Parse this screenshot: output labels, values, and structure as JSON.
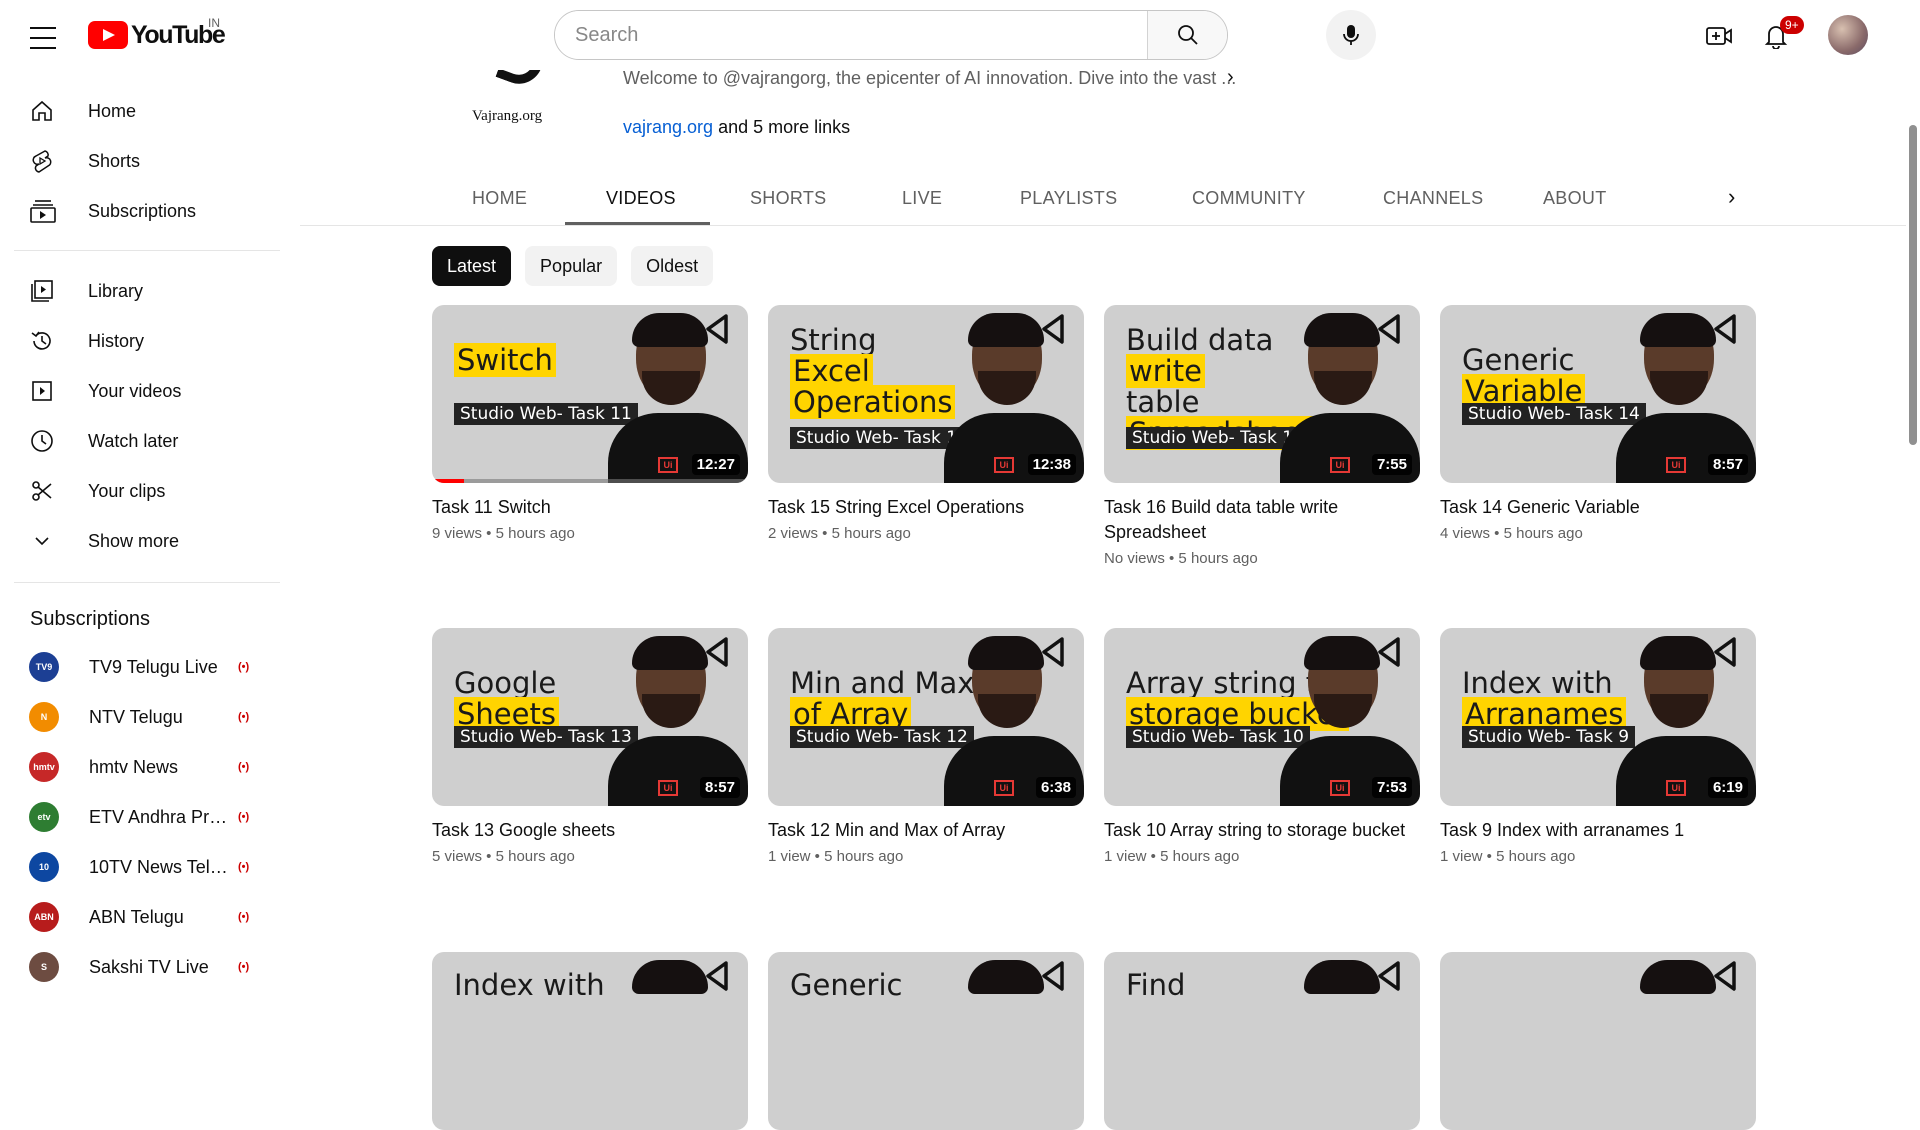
{
  "header": {
    "logo_text": "YouTube",
    "country_code": "IN",
    "search_placeholder": "Search",
    "notification_count": "9+"
  },
  "sidebar": {
    "main_items": [
      {
        "label": "Home",
        "icon": "home-icon"
      },
      {
        "label": "Shorts",
        "icon": "shorts-icon"
      },
      {
        "label": "Subscriptions",
        "icon": "subscriptions-icon"
      }
    ],
    "library_items": [
      {
        "label": "Library",
        "icon": "library-icon"
      },
      {
        "label": "History",
        "icon": "history-icon"
      },
      {
        "label": "Your videos",
        "icon": "your-videos-icon"
      },
      {
        "label": "Watch later",
        "icon": "watch-later-icon"
      },
      {
        "label": "Your clips",
        "icon": "clips-icon"
      },
      {
        "label": "Show more",
        "icon": "chevron-down-icon"
      }
    ],
    "subscriptions_heading": "Subscriptions",
    "subscriptions": [
      {
        "name": "TV9 Telugu Live",
        "avatar_text": "TV9",
        "color": "#1c3f94"
      },
      {
        "name": "NTV Telugu",
        "avatar_text": "N",
        "color": "#f28c00"
      },
      {
        "name": "hmtv News",
        "avatar_text": "hmtv",
        "color": "#c62828"
      },
      {
        "name": "ETV Andhra Pradesh",
        "avatar_text": "etv",
        "color": "#2e7d32"
      },
      {
        "name": "10TV News Telugu",
        "avatar_text": "10",
        "color": "#0d47a1"
      },
      {
        "name": "ABN Telugu",
        "avatar_text": "ABN",
        "color": "#b71c1c"
      },
      {
        "name": "Sakshi TV Live",
        "avatar_text": "S",
        "color": "#6d4c41"
      }
    ]
  },
  "channel": {
    "logo_name": "Vajrang.org",
    "description": "Welcome to @vajrangorg, the epicenter of AI innovation. Dive into the vast ...",
    "link_text": "vajrang.org",
    "more_links": "and 5 more links"
  },
  "tabs": [
    "HOME",
    "VIDEOS",
    "SHORTS",
    "LIVE",
    "PLAYLISTS",
    "COMMUNITY",
    "CHANNELS",
    "ABOUT"
  ],
  "active_tab": "VIDEOS",
  "chips": [
    "Latest",
    "Popular",
    "Oldest"
  ],
  "videos": [
    {
      "title": "Task 11 Switch",
      "meta": "9 views • 5 hours ago",
      "duration": "12:27",
      "thumb_line1": "",
      "thumb_hl1": "Switch",
      "thumb_line2": "",
      "thumb_hl2": "",
      "thumb_sub": "Studio Web- Task 11",
      "progress": 0.1
    },
    {
      "title": "Task 15 String Excel Operations",
      "meta": "2 views • 5 hours ago",
      "duration": "12:38",
      "thumb_line1": "String",
      "thumb_hl1": "Excel",
      "thumb_line2": "",
      "thumb_hl2": "Operations",
      "thumb_sub": "Studio Web- Task 15",
      "progress": 0
    },
    {
      "title": "Task 16 Build data table write Spreadsheet",
      "meta": "No views • 5 hours ago",
      "duration": "7:55",
      "thumb_line1": "Build data",
      "thumb_hl1": "write",
      "thumb_line2": "table",
      "thumb_hl2": "Spreadsheet",
      "thumb_sub": "Studio Web- Task 16",
      "progress": 0
    },
    {
      "title": "Task 14 Generic Variable",
      "meta": "4 views • 5 hours ago",
      "duration": "8:57",
      "thumb_line1": "Generic",
      "thumb_hl1": "Variable",
      "thumb_line2": "",
      "thumb_hl2": "",
      "thumb_sub": "Studio Web- Task 14",
      "progress": 0
    },
    {
      "title": "Task 13 Google sheets",
      "meta": "5 views • 5 hours ago",
      "duration": "8:57",
      "thumb_line1": "Google",
      "thumb_hl1": "Sheets",
      "thumb_line2": "",
      "thumb_hl2": "",
      "thumb_sub": "Studio Web- Task 13",
      "progress": 0
    },
    {
      "title": "Task 12 Min and Max of Array",
      "meta": "1 view • 5 hours ago",
      "duration": "6:38",
      "thumb_line1": "Min and Max",
      "thumb_hl1": "of Array",
      "thumb_line2": "",
      "thumb_hl2": "",
      "thumb_sub": "Studio Web- Task 12",
      "progress": 0
    },
    {
      "title": "Task 10 Array string to storage bucket",
      "meta": "1 view • 5 hours ago",
      "duration": "7:53",
      "thumb_line1": "Array string to",
      "thumb_hl1": "storage bucket",
      "thumb_line2": "",
      "thumb_hl2": "",
      "thumb_sub": "Studio Web- Task 10",
      "progress": 0
    },
    {
      "title": "Task 9 Index with arranames 1",
      "meta": "1 view • 5 hours ago",
      "duration": "6:19",
      "thumb_line1": "Index with",
      "thumb_hl1": "Arranames",
      "thumb_line2": "",
      "thumb_hl2": "",
      "thumb_sub": "Studio Web- Task 9",
      "progress": 0
    }
  ],
  "next_row_thumb_texts": [
    "Index with",
    "Generic",
    "Find",
    ""
  ]
}
